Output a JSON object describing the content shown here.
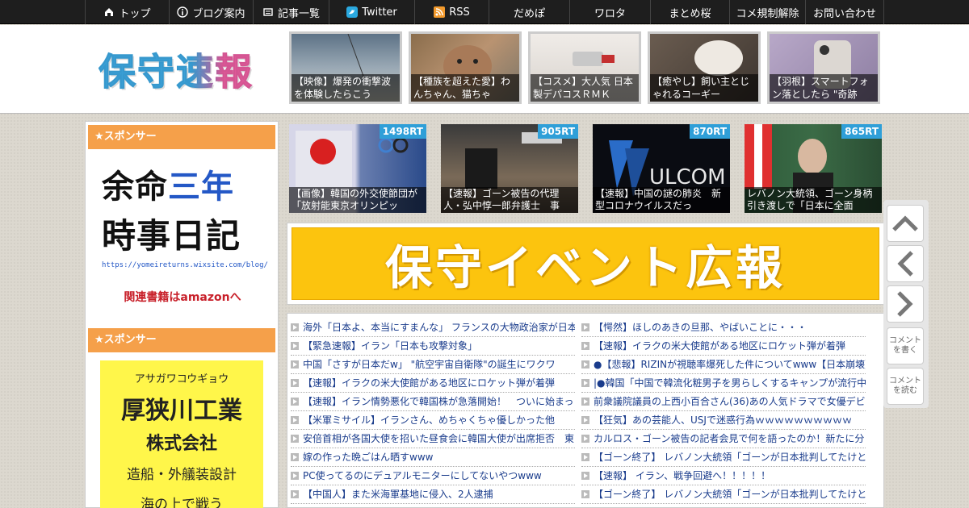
{
  "nav": {
    "items": [
      {
        "label": "トップ",
        "icon": "home-icon"
      },
      {
        "label": "ブログ案内",
        "icon": "info-icon"
      },
      {
        "label": "記事一覧",
        "icon": "list-icon"
      },
      {
        "label": "Twitter",
        "icon": "twitter-icon"
      },
      {
        "label": "RSS",
        "icon": "rss-icon"
      },
      {
        "label": "だめぽ",
        "icon": ""
      },
      {
        "label": "ワロタ",
        "icon": ""
      },
      {
        "label": "まとめ桜",
        "icon": ""
      },
      {
        "label": "コメ規制解除",
        "icon": ""
      },
      {
        "label": "お問い合わせ",
        "icon": ""
      }
    ]
  },
  "header": {
    "logo": "保守速報",
    "thumbs": [
      {
        "caption": "【映像】爆発の衝撃波を体験したらこう"
      },
      {
        "caption": "【種族を超えた愛】わんちゃん、猫ちゃ"
      },
      {
        "caption": "【コスメ】大人気 日本製デパコスＲＭＫ"
      },
      {
        "caption": "【癒やし】飼い主とじゃれるコーギー"
      },
      {
        "caption": "【羽根】スマートフォン落としたら \"奇跡"
      }
    ]
  },
  "sidebar": {
    "sponsor_label_1": "★スポンサー",
    "sponsor_label_2": "★スポンサー",
    "ad1": {
      "line1_a": "余命",
      "line1_b": "三年",
      "line2": "時事日記",
      "url": "https://yomeireturns.wixsite.com/blog/",
      "amazon": "関連書籍はamazonへ"
    },
    "ad2": {
      "kana": "アサガワコウギョウ",
      "name": "厚狭川工業",
      "corp": "株式会社",
      "service": "造船・外艤装設計",
      "tag": "海の上で戦う"
    }
  },
  "featured": [
    {
      "rt": "1498RT",
      "caption": "【画像】韓国の外交使節団が「放射能東京オリンピッ"
    },
    {
      "rt": "905RT",
      "caption": "【速報】ゴーン被告の代理人・弘中惇一郎弁護士　事"
    },
    {
      "rt": "870RT",
      "caption": "【速報】中国の謎の肺炎　新型コロナウイルスだっ"
    },
    {
      "rt": "865RT",
      "caption": "レバノン大統領、ゴーン身柄引き渡しで「日本に全面"
    }
  ],
  "banner": {
    "text": "保守イベント広報"
  },
  "list_left": [
    "海外「日本よ、本当にすまんな」 フランスの大物政治家が日本",
    "【緊急速報】イラン「日本も攻撃対象」",
    "中国「さすが日本だw」 \"航空宇宙自衛隊\"の誕生にワクワ",
    "【速報】イラクの米大使館がある地区にロケット弾が着弾",
    "【速報】イラン情勢悪化で韓国株が急落開始！　ついに始まっ",
    "【米軍ミサイル】イランさん、めちゃくちゃ優しかった他",
    "安倍首相が各国大使を招いた昼食会に韓国大使が出席拒否　東",
    "嫁の作った晩ごはん晒すwww",
    "PC使ってるのにデュアルモニターにしてないやつwww",
    "【中国人】また米海軍基地に侵入、2人逮捕"
  ],
  "list_right": [
    "【愕然】ほしのあきの旦那、やばいことに・・・",
    "【速報】イラクの米大使館がある地区にロケット弾が着弾",
    "●【悲報】RIZINが視聴率爆死した件についてwww【日本崩壊】",
    "|●韓国「中国で韓流化粧男子を男らしくするキャンプが流行中",
    "前衆議院議員の上西小百合さん(36)あの人気ドラマで女優デビ",
    "【狂気】あの芸能人、USJで迷惑行為ｗｗｗｗｗｗｗｗｗｗ",
    "カルロス・ゴーン被告の記者会見で何を語ったのか！新たに分",
    "【ゴーン終了】 レバノン大統領「ゴーンが日本批判してたけと",
    "【速報】 イラン、戦争回避へ！！！！！",
    "【ゴーン終了】 レバノン大統領「ゴーンが日本批判してたけと"
  ],
  "side_buttons": {
    "write_comment": "コメントを書く",
    "read_comment": "コメントを読む"
  }
}
